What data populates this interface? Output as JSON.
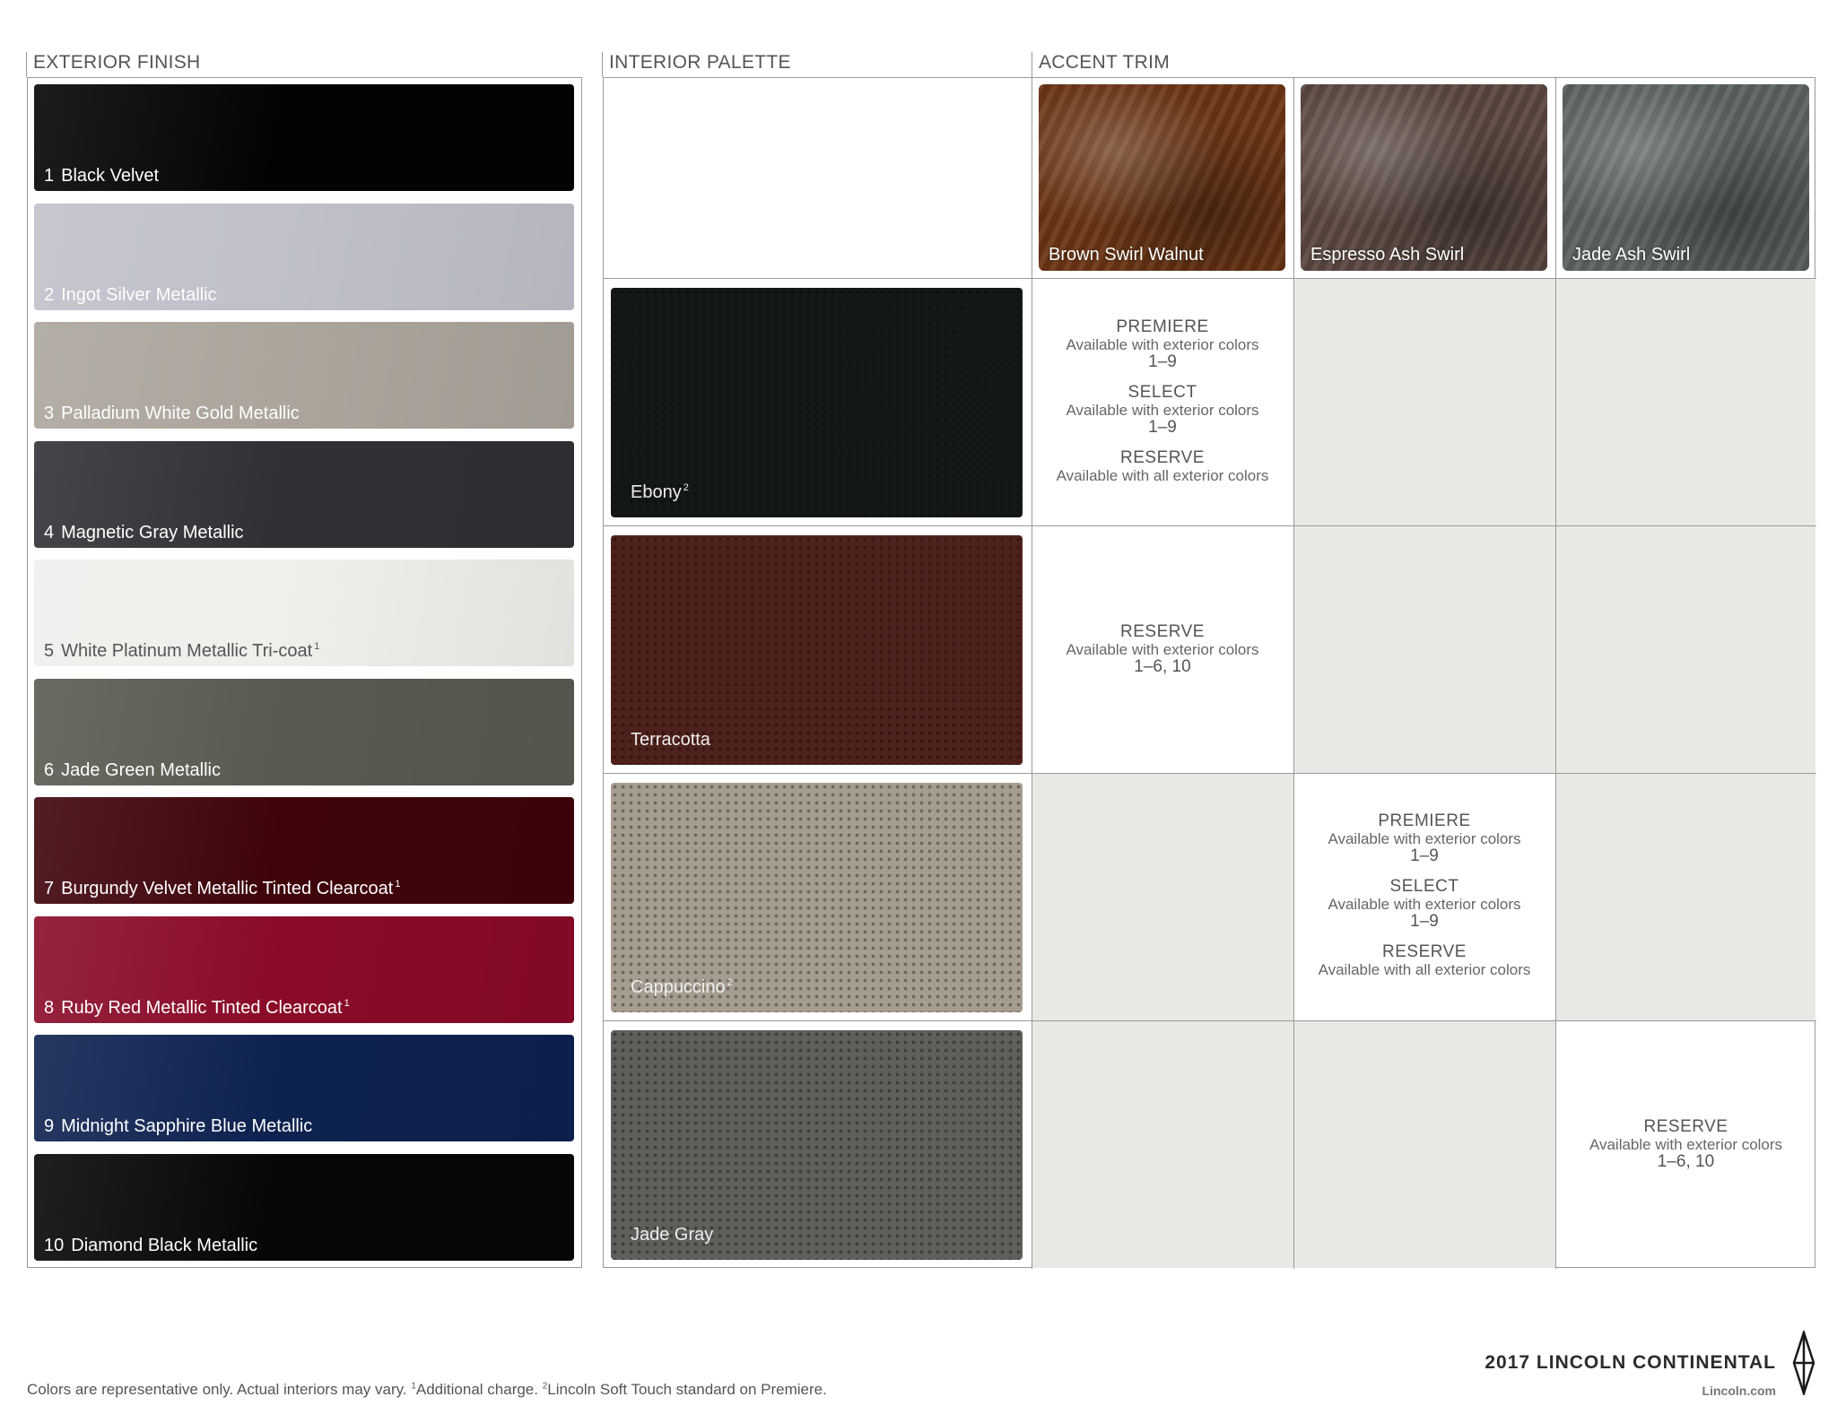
{
  "headers": {
    "exterior": "EXTERIOR FINISH",
    "interior": "INTERIOR PALETTE",
    "accent": "ACCENT TRIM"
  },
  "exterior_finishes": [
    {
      "number": "1",
      "name": "Black Velvet",
      "sup": "",
      "color": "#030303"
    },
    {
      "number": "2",
      "name": "Ingot Silver Metallic",
      "sup": "",
      "color": "#bfc0c9"
    },
    {
      "number": "3",
      "name": "Palladium White Gold Metallic",
      "sup": "",
      "color": "#aba59c"
    },
    {
      "number": "4",
      "name": "Magnetic Gray Metallic",
      "sup": "",
      "color": "#2f3135"
    },
    {
      "number": "5",
      "name": "White Platinum Metallic Tri-coat",
      "sup": "1",
      "color": "#eef0ec"
    },
    {
      "number": "6",
      "name": "Jade Green Metallic",
      "sup": "",
      "color": "#585b50"
    },
    {
      "number": "7",
      "name": "Burgundy Velvet Metallic Tinted Clearcoat",
      "sup": "1",
      "color": "#3f040b"
    },
    {
      "number": "8",
      "name": "Ruby Red Metallic Tinted Clearcoat",
      "sup": "1",
      "color": "#8a0b28"
    },
    {
      "number": "9",
      "name": "Midnight Sapphire Blue Metallic",
      "sup": "",
      "color": "#0e2250"
    },
    {
      "number": "10",
      "name": "Diamond Black Metallic",
      "sup": "",
      "color": "#060606"
    }
  ],
  "interior_palette": [
    {
      "name": "Ebony",
      "sup": "2",
      "color": "#141718"
    },
    {
      "name": "Terracotta",
      "sup": "",
      "color": "#4f211c"
    },
    {
      "name": "Cappuccino",
      "sup": "2",
      "color": "#a69d90"
    },
    {
      "name": "Jade Gray",
      "sup": "",
      "color": "#5d5f5b"
    }
  ],
  "accent_trims": [
    {
      "name": "Brown Swirl Walnut",
      "color": "#6b3514"
    },
    {
      "name": "Espresso Ash Swirl",
      "color": "#5a4740"
    },
    {
      "name": "Jade Ash Swirl",
      "color": "#5b6360"
    }
  ],
  "availability": {
    "ebony_walnut": [
      {
        "title": "PREMIERE",
        "desc": "Available with exterior colors",
        "range": "1–9"
      },
      {
        "title": "SELECT",
        "desc": "Available with exterior colors",
        "range": "1–9"
      },
      {
        "title": "RESERVE",
        "desc": "Available with all exterior colors",
        "range": ""
      }
    ],
    "terracotta_walnut": [
      {
        "title": "RESERVE",
        "desc": "Available with exterior colors",
        "range": "1–6, 10"
      }
    ],
    "cappuccino_espresso": [
      {
        "title": "PREMIERE",
        "desc": "Available with exterior colors",
        "range": "1–9"
      },
      {
        "title": "SELECT",
        "desc": "Available with exterior colors",
        "range": "1–9"
      },
      {
        "title": "RESERVE",
        "desc": "Available with all exterior colors",
        "range": ""
      }
    ],
    "jadegray_jadeash": [
      {
        "title": "RESERVE",
        "desc": "Available with exterior colors",
        "range": "1–6, 10"
      }
    ]
  },
  "footer": {
    "note_1": "Colors are representative only. Actual interiors may vary. ",
    "note_sup1": "1",
    "note_2": "Additional charge. ",
    "note_sup2": "2",
    "note_3": "Lincoln Soft Touch standard on Premiere.",
    "brand_title": "2017 LINCOLN CONTINENTAL",
    "brand_url": "Lincoln.com"
  }
}
